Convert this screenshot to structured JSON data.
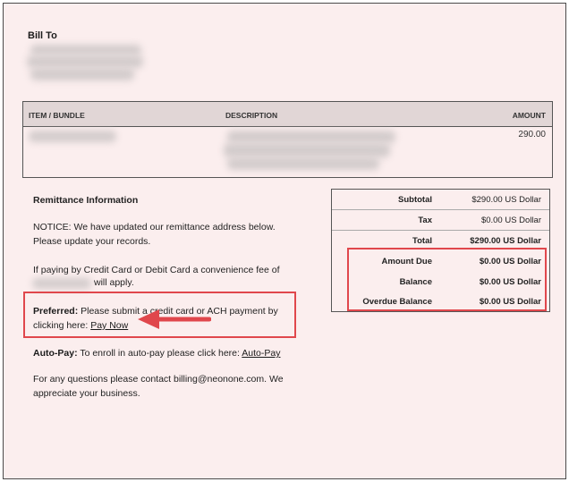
{
  "bill_to": {
    "label": "Bill To"
  },
  "items_table": {
    "columns": [
      "ITEM / BUNDLE",
      "DESCRIPTION",
      "AMOUNT"
    ],
    "rows": [
      {
        "amount": "290.00"
      }
    ]
  },
  "remittance": {
    "title": "Remittance Information",
    "notice": "NOTICE: We have updated our remittance address below. Please update your records.",
    "fee_text": "If paying by Credit Card or Debit Card a convenience fee of",
    "fee_tail": "will apply.",
    "preferred_label": "Preferred:",
    "preferred_text": "Please submit a credit card or ACH payment by clicking here:",
    "pay_now_link": "Pay Now",
    "autopay_label": "Auto-Pay:",
    "autopay_text": "To enroll in auto-pay please click here:",
    "autopay_link": "Auto-Pay",
    "questions": "For any questions please contact billing@neonone.com.  We appreciate your business."
  },
  "totals": [
    {
      "label": "Subtotal",
      "value": "$290.00 US Dollar"
    },
    {
      "label": "Tax",
      "value": "$0.00 US Dollar"
    },
    {
      "label": "Total",
      "value": "$290.00 US Dollar"
    },
    {
      "label": "Amount Due",
      "value": "$0.00 US Dollar"
    },
    {
      "label": "Balance",
      "value": "$0.00 US Dollar"
    },
    {
      "label": "Overdue Balance",
      "value": "$0.00 US Dollar"
    }
  ],
  "colors": {
    "page_background": "#fbeeee",
    "table_header": "#e1d6d6",
    "highlight": "#e0474c"
  }
}
